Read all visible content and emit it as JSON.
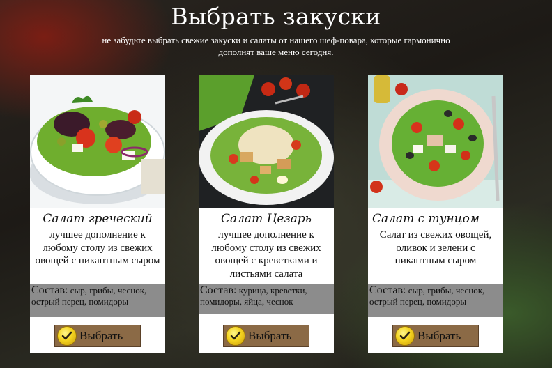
{
  "header": {
    "title": "Выбрать закуски",
    "subtitle": "не забудьте выбрать свежие закуски и салаты от нашего шеф-повара, которые гармонично дополнят ваше меню сегодня."
  },
  "cards": [
    {
      "name": "Салат греческий",
      "description": "лучшее дополнение к любому столу из свежих овощей с пикантным сыром",
      "composition_label": "Состав:",
      "composition": "сыр, грибы, чеснок, острый перец, помидоры",
      "button_label": "Выбрать"
    },
    {
      "name": "Салат Цезарь",
      "description": "лучшее дополнение к любому столу из свежих овощей с креветками и листьями салата",
      "composition_label": "Состав:",
      "composition": "курица, креветки, помидоры, яйца, чеснок",
      "button_label": "Выбрать"
    },
    {
      "name": "Салат с тунцом",
      "description": "Салат из свежих овощей, оливок и зелени с пикантным сыром",
      "composition_label": "Состав:",
      "composition": "сыр, грибы, чеснок, острый перец, помидоры",
      "button_label": "Выбрать"
    }
  ],
  "icons": {
    "button_icon": "check-icon"
  },
  "colors": {
    "button_background": "#8b6a46",
    "composition_background": "#8c8c8c",
    "check_badge": "#f4d420"
  }
}
